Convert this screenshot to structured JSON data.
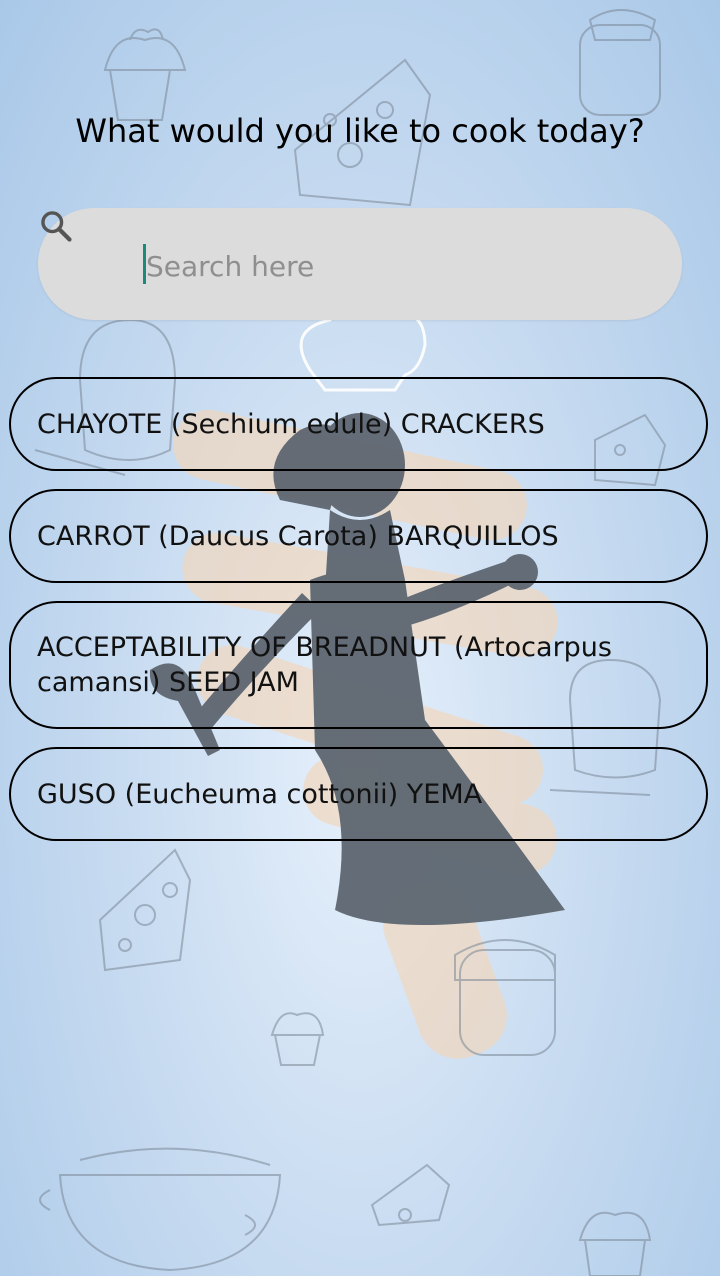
{
  "header": {
    "title": "What would you like to cook today?"
  },
  "search": {
    "placeholder": "Search here",
    "value": "",
    "icon": "search-icon"
  },
  "recipes": [
    {
      "label": "CHAYOTE (Sechium edule) CRACKERS"
    },
    {
      "label": "CARROT (Daucus Carota) BARQUILLOS"
    },
    {
      "label": "ACCEPTABILITY OF BREADNUT (Artocarpus camansi) SEED JAM"
    },
    {
      "label": "GUSO (Eucheuma cottonii) YEMA"
    }
  ],
  "colors": {
    "background": "#c9dcf1",
    "search_bg": "#dcdcdc",
    "caret": "#1a8a7a",
    "illustration": "#5d6670"
  }
}
